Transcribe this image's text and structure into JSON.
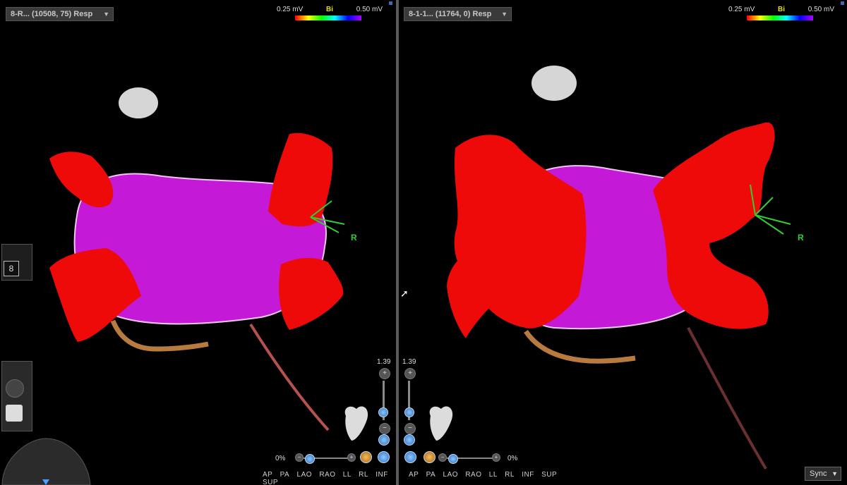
{
  "left_view": {
    "map_dropdown": "8-R... (10508, 75) Resp",
    "scale": {
      "min": "0.25 mV",
      "mode": "Bi",
      "max": "0.50 mV"
    },
    "orientation_label": "R",
    "zoom_value": "1.39",
    "rotation_percent": "0%",
    "view_buttons": [
      "AP",
      "PA",
      "LAO",
      "RAO",
      "LL",
      "RL",
      "INF",
      "SUP"
    ],
    "point_count": "8"
  },
  "right_view": {
    "map_dropdown": "8-1-1... (11764, 0) Resp",
    "scale": {
      "min": "0.25 mV",
      "mode": "Bi",
      "max": "0.50 mV"
    },
    "orientation_label": "R",
    "zoom_value": "1.39",
    "rotation_percent": "0%",
    "view_buttons": [
      "AP",
      "PA",
      "LAO",
      "RAO",
      "LL",
      "RL",
      "INF",
      "SUP"
    ]
  },
  "sync_dropdown": "Sync",
  "colors": {
    "tissue_red": "#ff0000",
    "voltage_purple": "#c000e0",
    "accent_green": "#33cc33",
    "background": "#000000"
  }
}
